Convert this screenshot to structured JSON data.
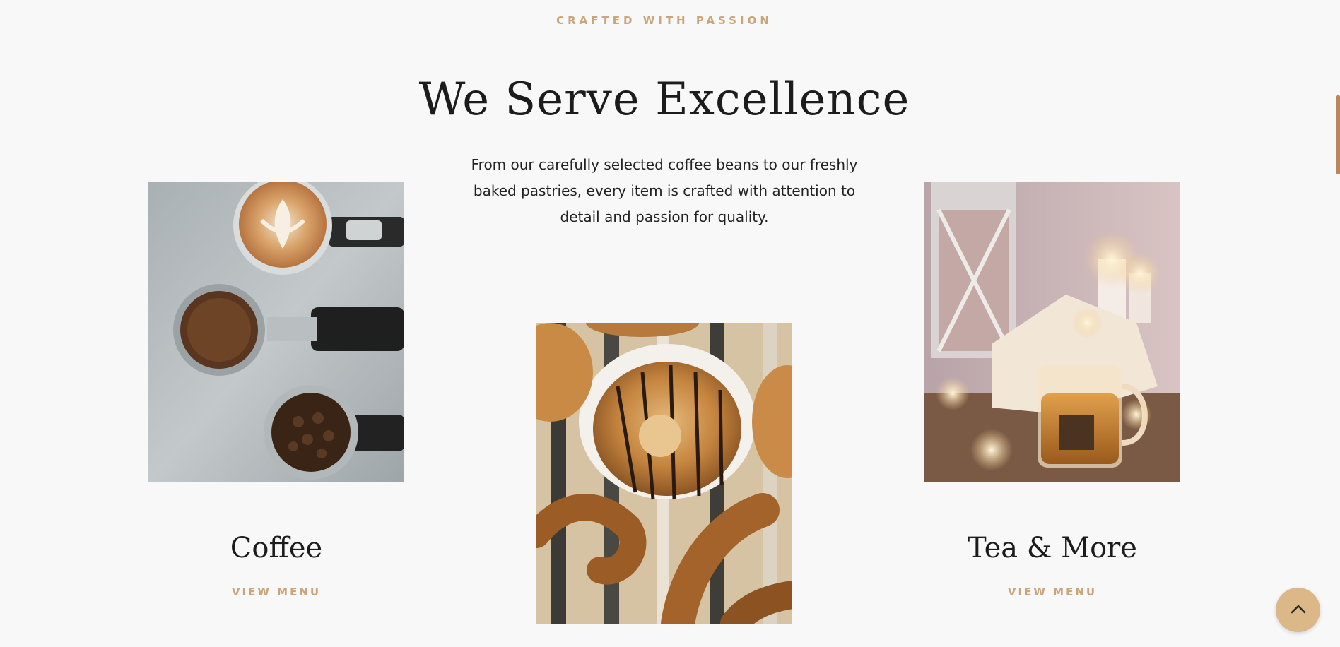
{
  "section": {
    "eyebrow": "CRAFTED WITH PASSION",
    "heading": "We Serve Excellence",
    "intro": "From our carefully selected coffee beans to our freshly baked pastries, every item is crafted with attention to detail and passion for quality."
  },
  "cards": [
    {
      "title": "Coffee",
      "link_label": "VIEW MENU",
      "image": "coffee-portafilters-image"
    },
    {
      "title": "",
      "link_label": "",
      "image": "pastries-image"
    },
    {
      "title": "Tea & More",
      "link_label": "VIEW MENU",
      "image": "tea-candles-image"
    }
  ],
  "scroll_top": {
    "icon": "chevron-up-icon"
  },
  "colors": {
    "background": "#f8f8f8",
    "accent": "#c9a57a",
    "button": "#dcb787",
    "text": "#1c1c1c",
    "scrollbar": "#b8875a"
  }
}
